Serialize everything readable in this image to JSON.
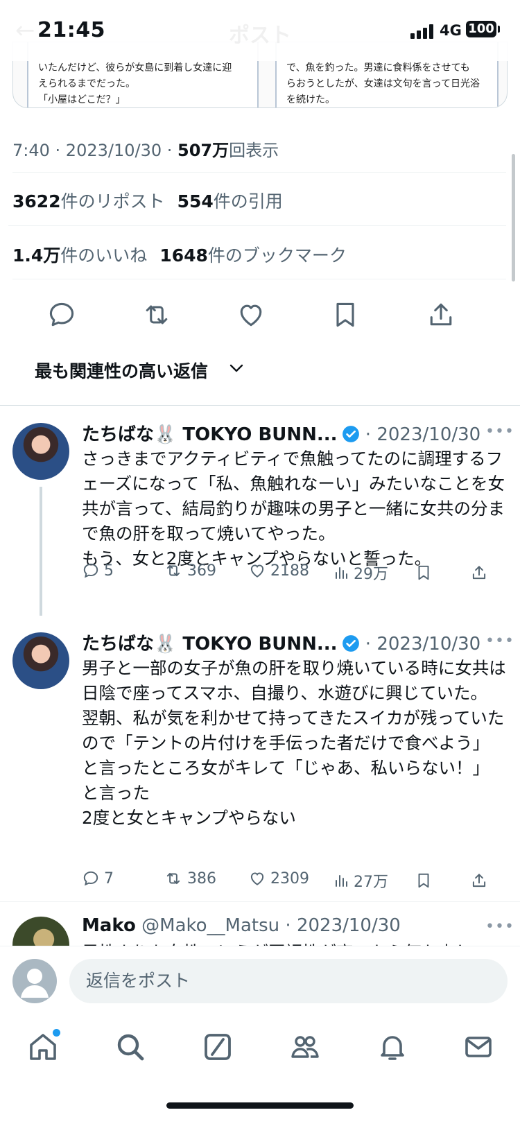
{
  "status_bar": {
    "time": "21:45",
    "network": "4G",
    "battery": "100"
  },
  "nav": {
    "title": "ポスト",
    "back_icon": "arrow-left-icon"
  },
  "media": {
    "left_text": "いたんだけど、彼らが女島に到着し女達に迎\nえられるまでだった。\n「小屋はどこだ？」",
    "right_text": "で、魚を釣った。男達に食料係をさせても\nらおうとしたが、女達は文句を言って日光浴\nを続けた。\n　男島に送られた女達うちは寝る準備でい"
  },
  "post_meta": {
    "time": "7:40",
    "sep1": " · ",
    "date": "2023/10/30",
    "sep2": " · ",
    "views_num": "507万",
    "views_label": "回表示"
  },
  "stats": {
    "reposts_num": "3622",
    "reposts_label": "件のリポスト",
    "quotes_num": "554",
    "quotes_label": "件の引用",
    "likes_num": "1.4万",
    "likes_label": "件のいいね",
    "bookmarks_num": "1648",
    "bookmarks_label": "件のブックマーク"
  },
  "actions": [
    "reply-icon",
    "repost-icon",
    "like-icon",
    "bookmark-icon",
    "share-icon"
  ],
  "reply_sort": {
    "label": "最も関連性の高い返信"
  },
  "replies": [
    {
      "name": "たちばな🐰 TOKYO BUNN...",
      "separator": " · ",
      "date": "2023/10/30",
      "more": "•••",
      "text": "さっきまでアクティビティで魚触ってたのに調理するフェーズになって「私、魚触れなーい」みたいなことを女共が言って、結局釣りが趣味の男子と一緒に女共の分まで魚の肝を取って焼いてやった。\nもう、女と2度とキャンプやらないと誓った。",
      "replies": "5",
      "reposts": "369",
      "likes": "2188",
      "views": "29万"
    },
    {
      "name": "たちばな🐰 TOKYO BUNN...",
      "separator": " · ",
      "date": "2023/10/30",
      "more": "•••",
      "text": "男子と一部の女子が魚の肝を取り焼いている時に女共は日陰で座ってスマホ、自撮り、水遊びに興じていた。\n翌朝、私が気を利かせて持ってきたスイカが残っていたので「テントの片付けを手伝った者だけで食べよう」と言ったところ女がキレて「じゃあ、私いらない！」と言った\n2度と女とキャンプやらない",
      "replies": "7",
      "reposts": "386",
      "likes": "2309",
      "views": "27万"
    },
    {
      "name": "Mako",
      "handle": "@Mako__Matsu",
      "separator": " · ",
      "date": "2023/10/30",
      "more": "•••",
      "text": "男性よりも女性のほうが同調性が高いから何か少し"
    }
  ],
  "compose": {
    "placeholder": "返信をポスト"
  },
  "tab_bar": [
    "home-icon",
    "search-icon",
    "grok-icon",
    "communities-icon",
    "notifications-icon",
    "messages-icon"
  ],
  "colors": {
    "accent": "#1d9bf0",
    "text": "#0f1419",
    "muted": "#536471",
    "border": "#eff3f4"
  }
}
